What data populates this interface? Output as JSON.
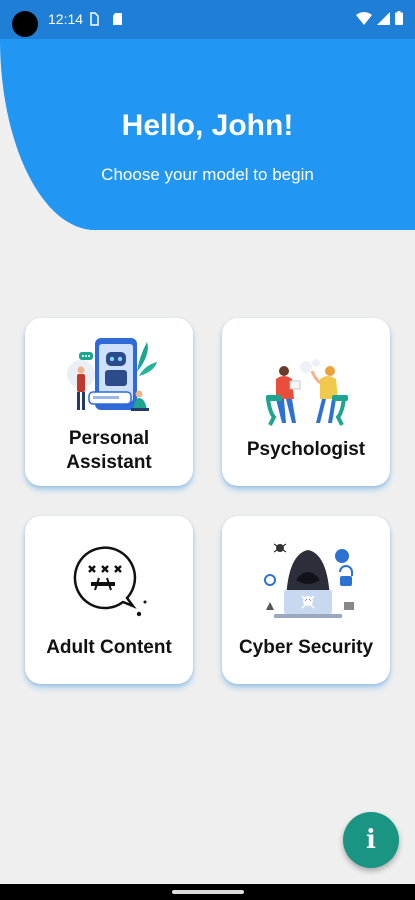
{
  "status_bar": {
    "time": "12:14",
    "icons": [
      "sim-icon",
      "sd-card-icon",
      "wifi-icon",
      "signal-icon",
      "battery-icon"
    ]
  },
  "header": {
    "title": "Hello, John!",
    "subtitle": "Choose your model to begin"
  },
  "models": [
    {
      "label_line1": "Personal",
      "label_line2": "Assistant",
      "icon": "robot-assistant-illustration"
    },
    {
      "label": "Psychologist",
      "icon": "therapy-session-illustration"
    },
    {
      "label": "Adult Content",
      "icon": "censored-face-illustration"
    },
    {
      "label": "Cyber Security",
      "icon": "hacker-illustration"
    }
  ],
  "fab": {
    "glyph": "i",
    "icon": "info-icon"
  },
  "colors": {
    "status_bar": "#1f7fd6",
    "header": "#2196f3",
    "background": "#efefef",
    "fab": "#1a9483"
  }
}
